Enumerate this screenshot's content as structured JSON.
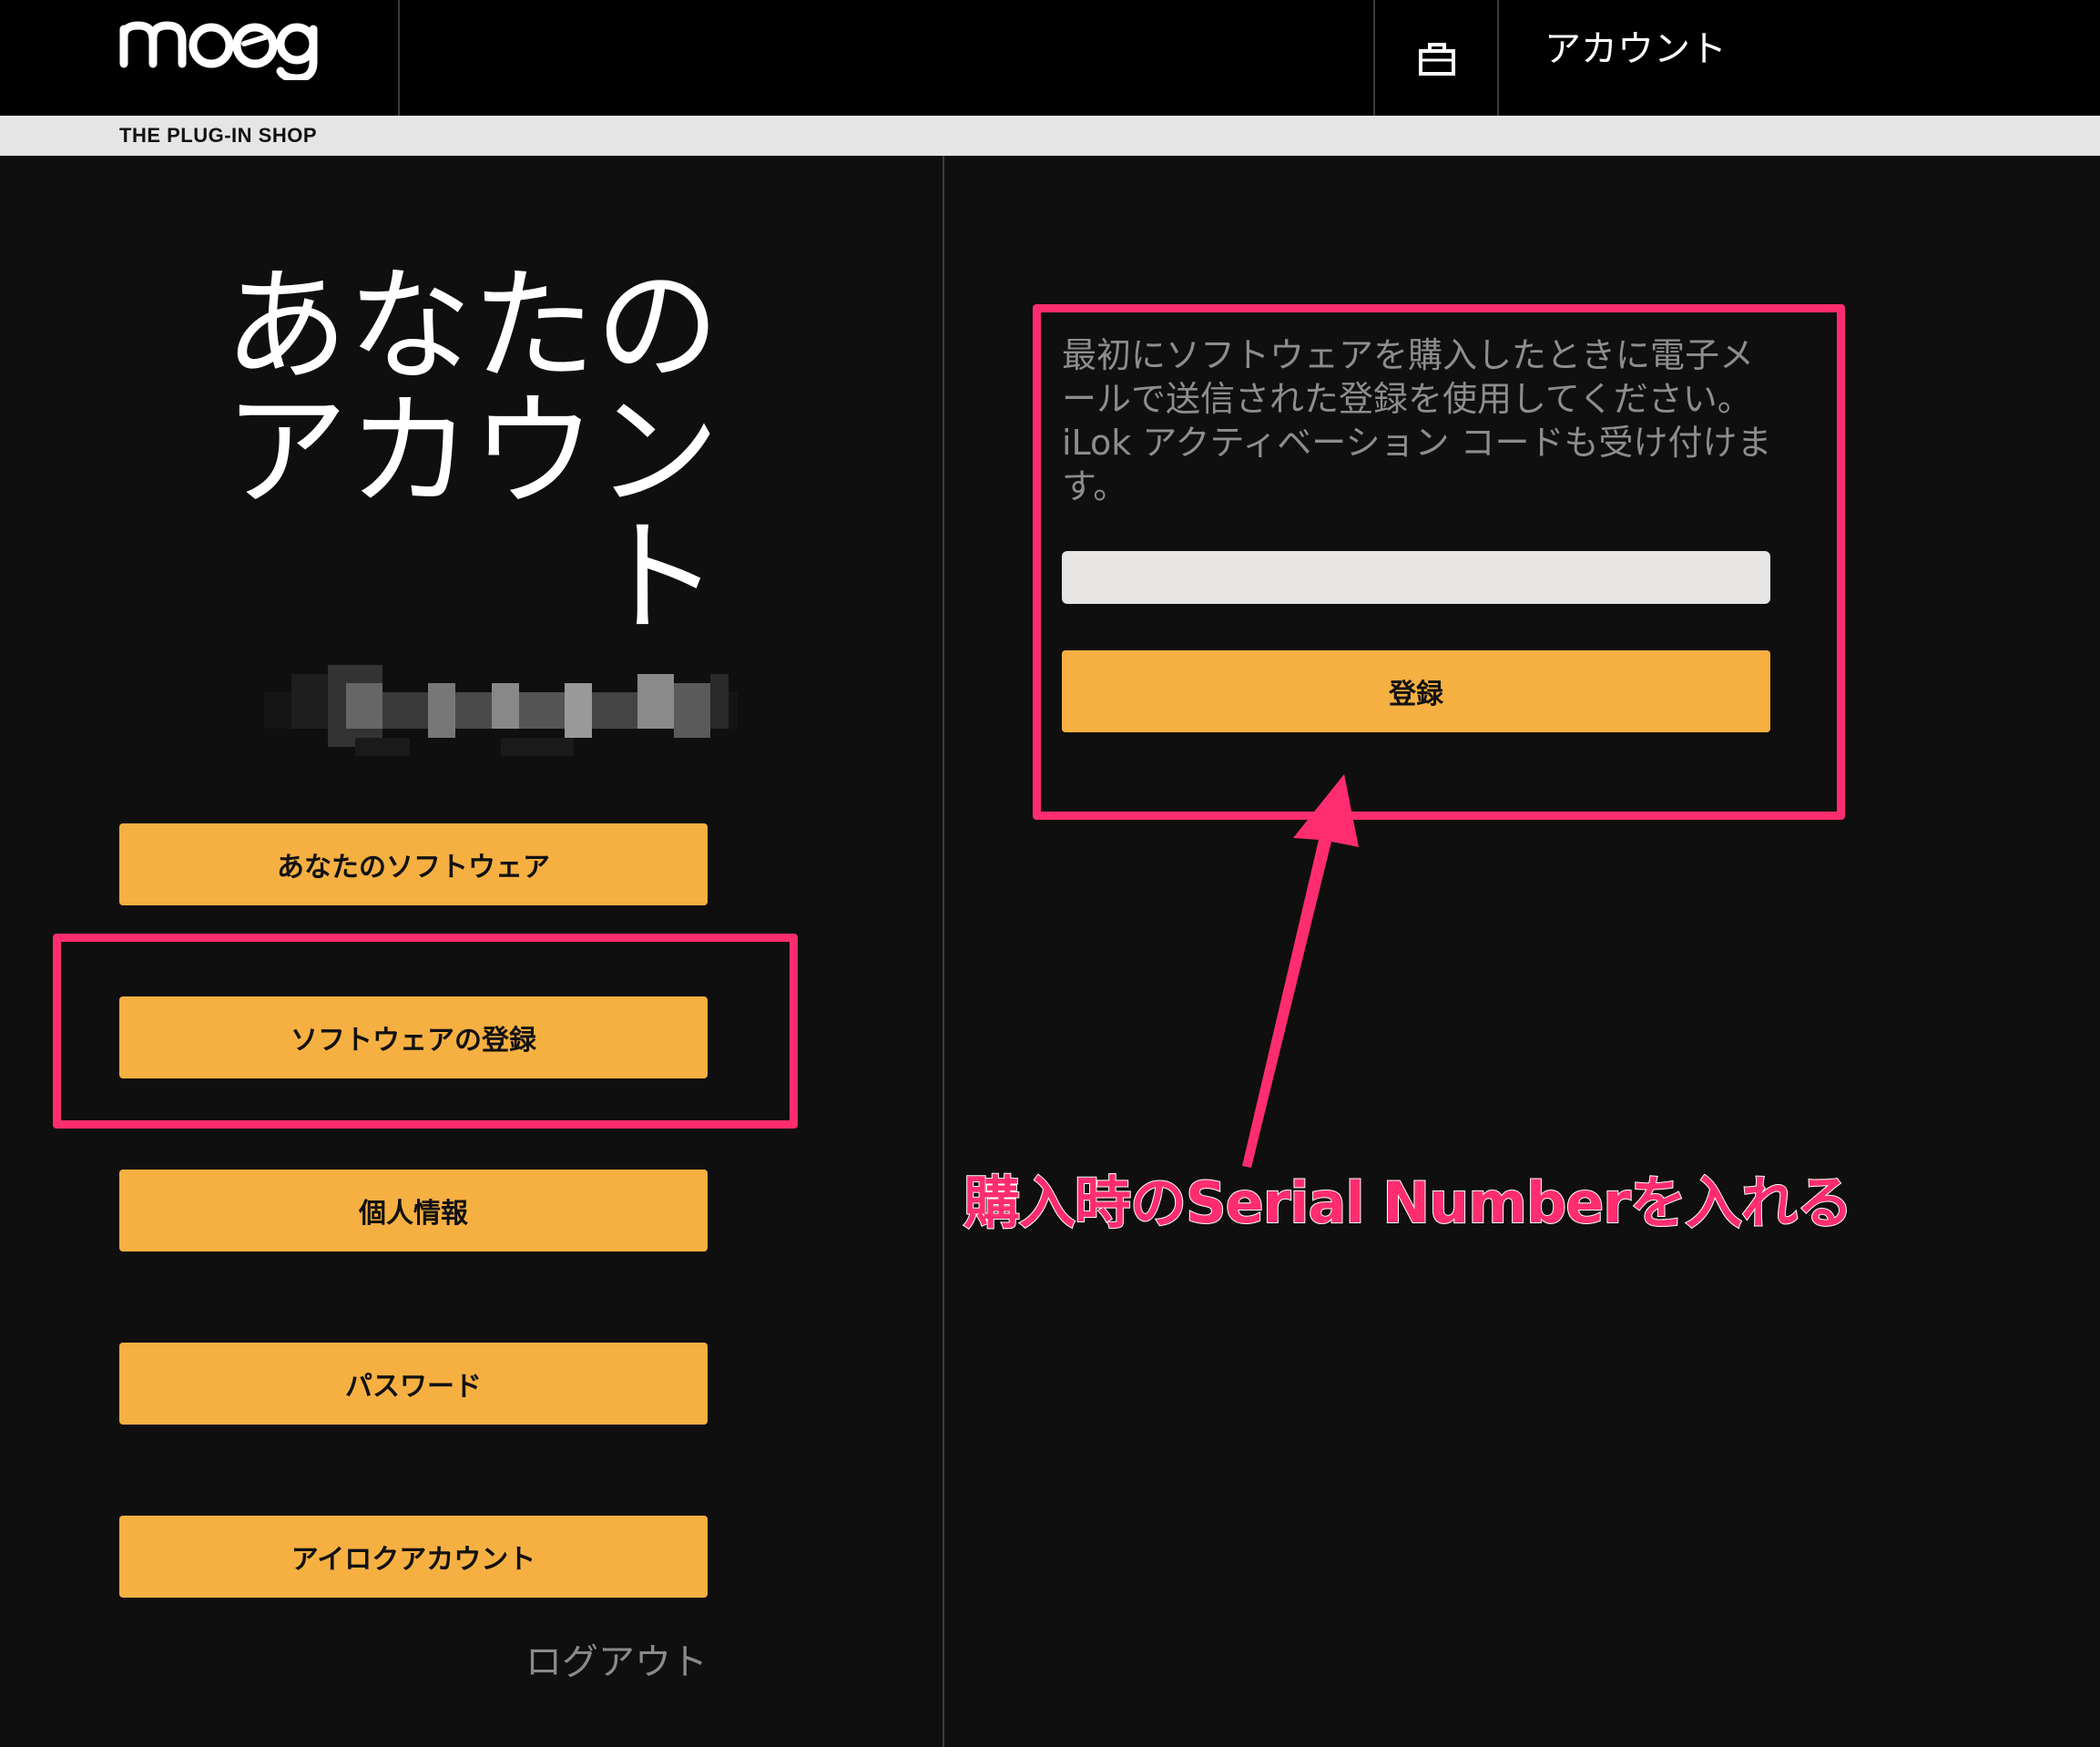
{
  "header": {
    "logo_text": "moog",
    "subbar_label": "THE PLUG-IN SHOP",
    "account_link": "アカウント"
  },
  "left": {
    "page_title_line1": "あなたの",
    "page_title_line2": "アカウン",
    "page_title_line3": "ト",
    "menu": {
      "your_software": "あなたのソフトウェア",
      "register_software": "ソフトウェアの登録",
      "personal_info": "個人情報",
      "password": "パスワード",
      "ilok_account": "アイロクアカウント"
    },
    "logout": "ログアウト"
  },
  "form": {
    "description": "最初にソフトウェアを購入したときに電子メールで送信された登録を使用してください。 iLok アクティベーション コードも受け付けます。",
    "input_value": "",
    "input_placeholder": "",
    "register_label": "登録"
  },
  "annotation": {
    "text": "購入時のSerial Numberを入れる",
    "color": "#ff2d6f"
  },
  "colors": {
    "accent": "#f6b042",
    "background": "#0f0f0f",
    "header": "#000000",
    "subbar": "#e5e5e5"
  }
}
